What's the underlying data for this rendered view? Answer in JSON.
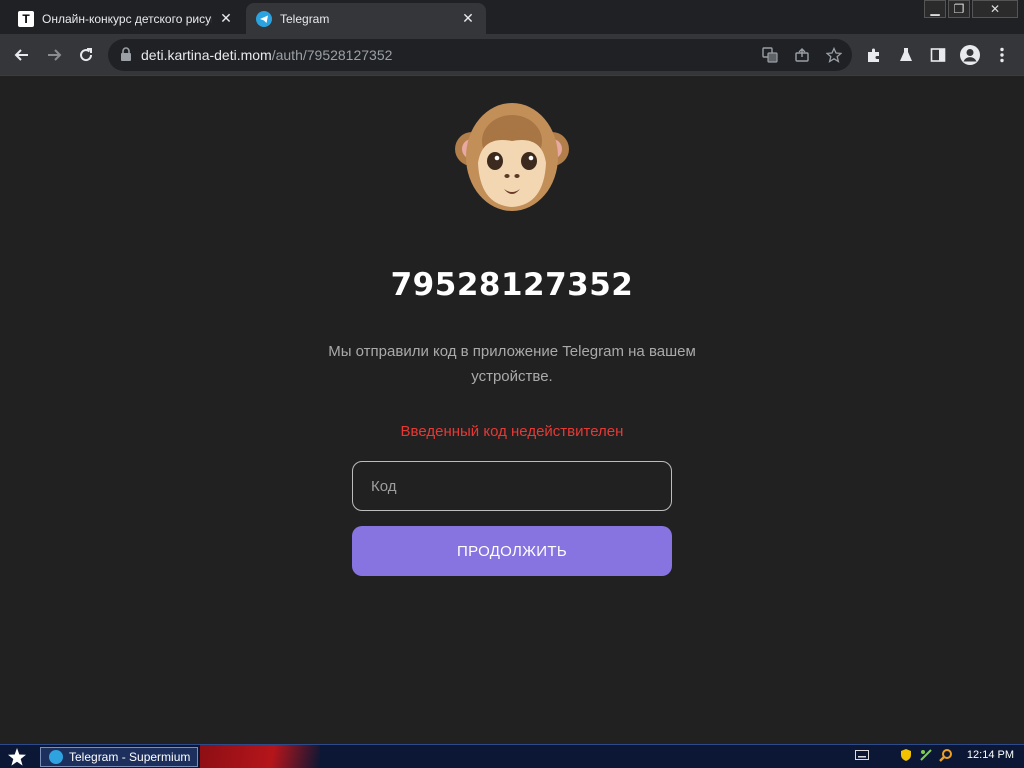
{
  "browser": {
    "tabs": [
      {
        "label": "Онлайн-конкурс детского рисунк",
        "favicon": "t-letter-icon",
        "favicon_text": "T",
        "active": false
      },
      {
        "label": "Telegram",
        "favicon": "telegram-icon",
        "active": true
      }
    ],
    "url_host": "deti.kartina-deti.mom",
    "url_path": "/auth/79528127352"
  },
  "page": {
    "phone_number": "79528127352",
    "description": "Мы отправили код в приложение Telegram на вашем устройстве.",
    "error_text": "Введенный код недействителен",
    "code_placeholder": "Код",
    "code_value": "",
    "continue_label": "ПРОДОЛЖИТЬ"
  },
  "taskbar": {
    "task_label": "Telegram - Supermium",
    "clock": "12:14 PM"
  },
  "colors": {
    "page_bg": "#212121",
    "accent": "#8774e1",
    "error": "#e53935"
  }
}
